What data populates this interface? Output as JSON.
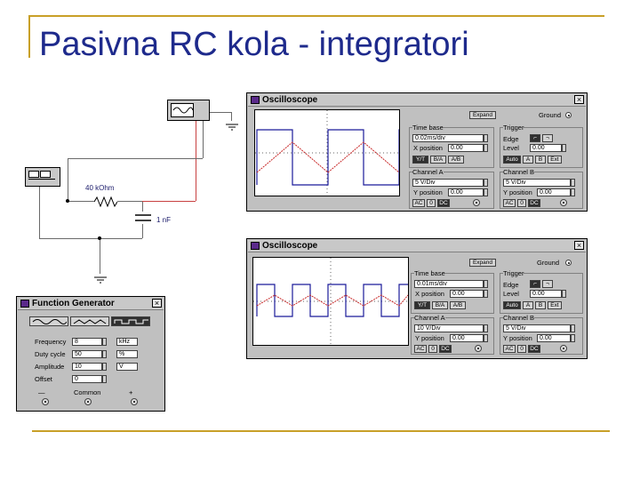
{
  "slide": {
    "title": "Pasivna RC kola - integratori",
    "accent_color": "#c8a028",
    "title_color": "#1e2a8c"
  },
  "circuit": {
    "resistor_label": "40 kOhm",
    "capacitor_label": "1 nF",
    "ground_symbol": "ground-icon"
  },
  "scope1": {
    "title": "Oscilloscope",
    "expand_label": "Expand",
    "ground_label": "Ground",
    "timebase_heading": "Time base",
    "timebase_value": "0.02ms/div",
    "xpos_label": "X position",
    "xpos_value": "0.00",
    "mode_buttons": [
      "Y/T",
      "B/A",
      "A/B"
    ],
    "trigger_heading": "Trigger",
    "edge_label": "Edge",
    "level_label": "Level",
    "level_value": "0.00",
    "trig_buttons": [
      "Auto",
      "A",
      "B",
      "Ext"
    ],
    "chA_heading": "Channel A",
    "chA_value": "5 V/Div",
    "chA_ypos_label": "Y position",
    "chA_ypos_value": "0.00",
    "chB_heading": "Channel B",
    "chB_value": "5 V/Div",
    "chB_ypos_label": "Y position",
    "chB_ypos_value": "0.00",
    "coupling": [
      "AC",
      "0",
      "DC"
    ]
  },
  "scope2": {
    "title": "Oscilloscope",
    "expand_label": "Expand",
    "ground_label": "Ground",
    "timebase_heading": "Time base",
    "timebase_value": "0.01ms/div",
    "xpos_label": "X position",
    "xpos_value": "0.00",
    "mode_buttons": [
      "Y/T",
      "B/A",
      "A/B"
    ],
    "trigger_heading": "Trigger",
    "edge_label": "Edge",
    "level_label": "Level",
    "level_value": "0.00",
    "trig_buttons": [
      "Auto",
      "A",
      "B",
      "Ext"
    ],
    "chA_heading": "Channel A",
    "chA_value": "10 V/Div",
    "chA_ypos_label": "Y position",
    "chA_ypos_value": "0.00",
    "chB_heading": "Channel B",
    "chB_value": "5 V/Div",
    "chB_ypos_label": "Y position",
    "chB_ypos_value": "0.00",
    "coupling": [
      "AC",
      "0",
      "DC"
    ]
  },
  "fg": {
    "title": "Function Generator",
    "rows": [
      {
        "label": "Frequency",
        "value": "8",
        "unit": "kHz"
      },
      {
        "label": "Duty cycle",
        "value": "50",
        "unit": "%"
      },
      {
        "label": "Amplitude",
        "value": "10",
        "unit": "V"
      },
      {
        "label": "Offset",
        "value": "0",
        "unit": ""
      }
    ],
    "minus_label": "—",
    "common_label": "Common",
    "plus_label": "+"
  },
  "waves": {
    "square_color": "#1a1a9a",
    "triangle_color": "#c82828"
  }
}
